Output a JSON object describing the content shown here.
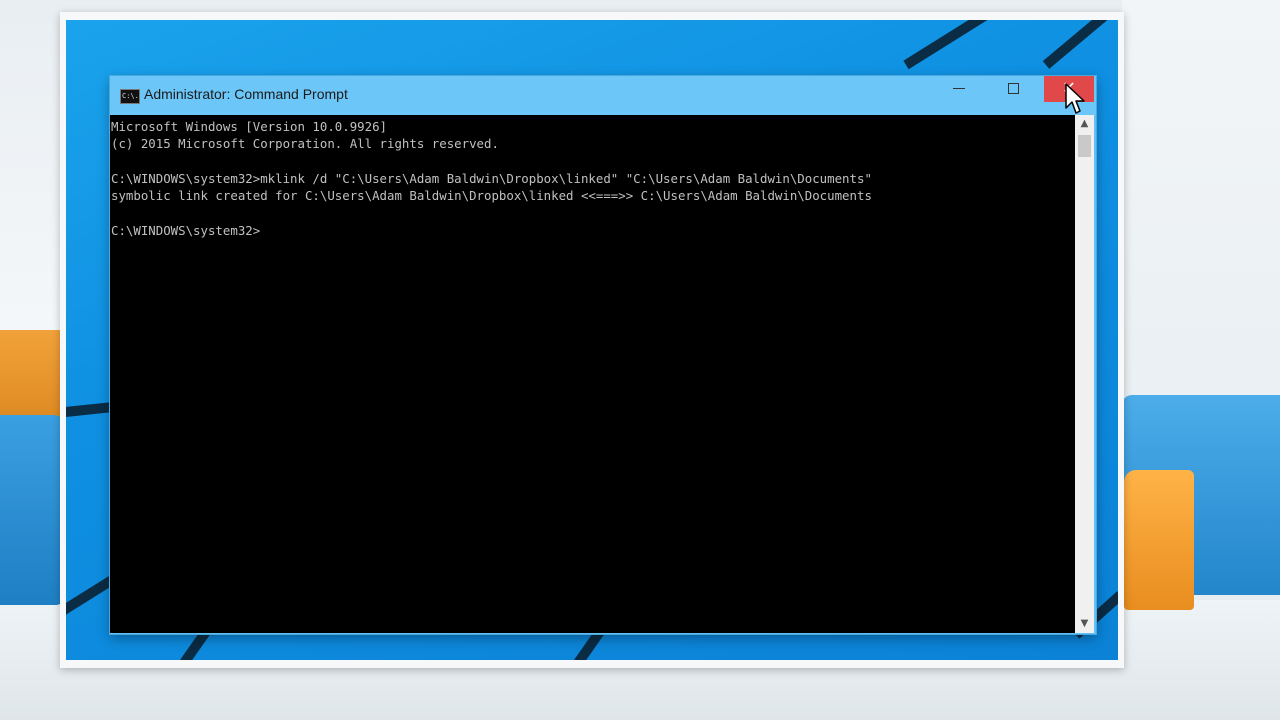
{
  "window": {
    "title": "Administrator: Command Prompt",
    "icon_name": "cmd-icon",
    "icon_text": "C:\\."
  },
  "controls": {
    "minimize_icon": "minimize-icon",
    "maximize_icon": "maximize-icon",
    "close_icon": "close-icon",
    "close_glyph": "✕"
  },
  "console": {
    "lines": [
      "Microsoft Windows [Version 10.0.9926]",
      "(c) 2015 Microsoft Corporation. All rights reserved.",
      "",
      "C:\\WINDOWS\\system32>mklink /d \"C:\\Users\\Adam Baldwin\\Dropbox\\linked\" \"C:\\Users\\Adam Baldwin\\Documents\"",
      "symbolic link created for C:\\Users\\Adam Baldwin\\Dropbox\\linked <<===>> C:\\Users\\Adam Baldwin\\Documents",
      "",
      "C:\\WINDOWS\\system32>"
    ],
    "background": "#000000",
    "foreground": "#c0c0c0"
  },
  "scrollbar": {
    "up_arrow": "▲",
    "down_arrow": "▼"
  },
  "colors": {
    "title_bar": "#6cc6f8",
    "close_button": "#e0484a",
    "desktop": "#0f90e2"
  }
}
